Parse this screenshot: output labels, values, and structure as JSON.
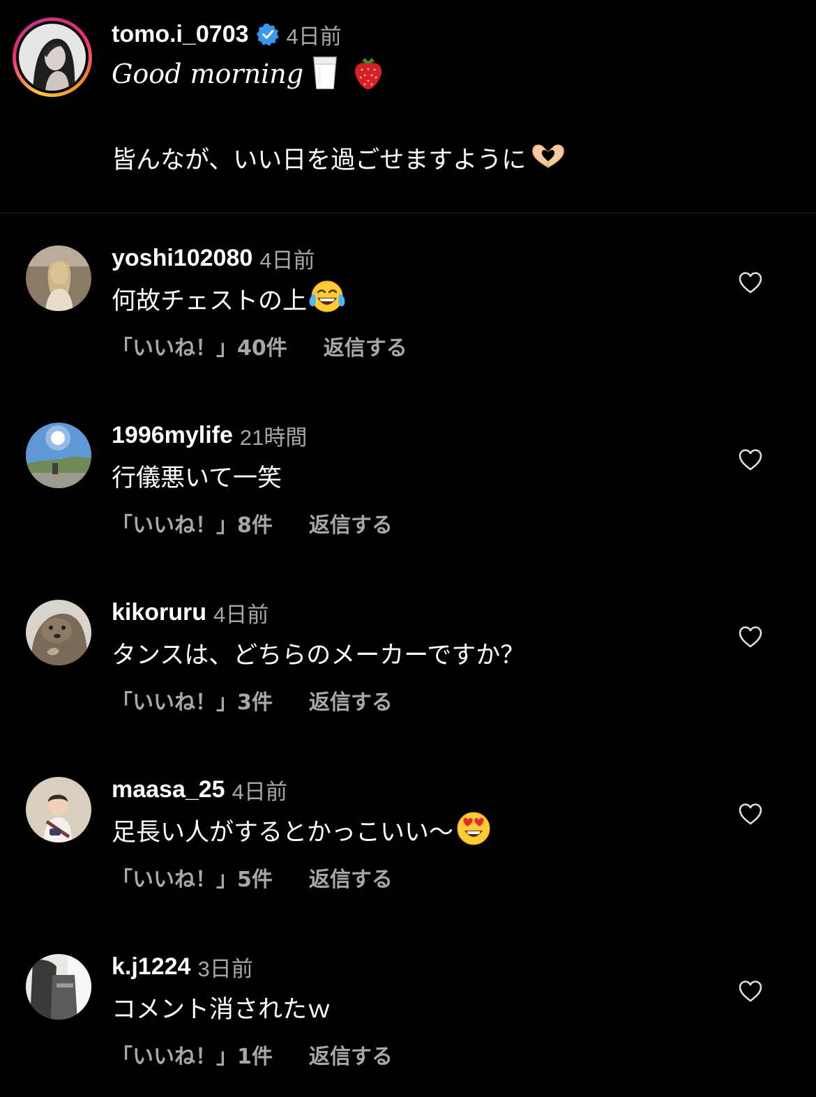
{
  "post": {
    "username": "tomo.i_0703",
    "verified": true,
    "time": "4日前",
    "caption_title": "Good morning",
    "caption_title_emojis": [
      "milk-glass-emoji",
      "strawberry-emoji"
    ],
    "caption_body": "皆んなが、いい日を過ごせますように",
    "caption_body_emoji": "heart-hands-emoji"
  },
  "comments": [
    {
      "username": "yoshi102080",
      "time": "4日前",
      "text": "何故チェストの上",
      "emoji": "tears-of-joy-emoji",
      "likes": "「いいね！」40件",
      "reply": "返信する"
    },
    {
      "username": "1996mylife",
      "time": "21時間",
      "text": "行儀悪いて一笑",
      "emoji": "",
      "likes": "「いいね！」8件",
      "reply": "返信する"
    },
    {
      "username": "kikoruru",
      "time": "4日前",
      "text": "タンスは、どちらのメーカーですか？",
      "emoji": "",
      "likes": "「いいね！」3件",
      "reply": "返信する"
    },
    {
      "username": "maasa_25",
      "time": "4日前",
      "text": "足長い人がするとかっこいい〜",
      "emoji": "heart-eyes-emoji",
      "likes": "「いいね！」5件",
      "reply": "返信する"
    },
    {
      "username": "k.j1224",
      "time": "3日前",
      "text": "コメント消されたｗ",
      "emoji": "",
      "likes": "「いいね！」1件",
      "reply": "返信する"
    }
  ],
  "colors": {
    "background": "#000000",
    "primary_text": "#ffffff",
    "secondary_text": "#a8a8a8",
    "verified_badge": "#3897f0",
    "divider": "#262626"
  }
}
